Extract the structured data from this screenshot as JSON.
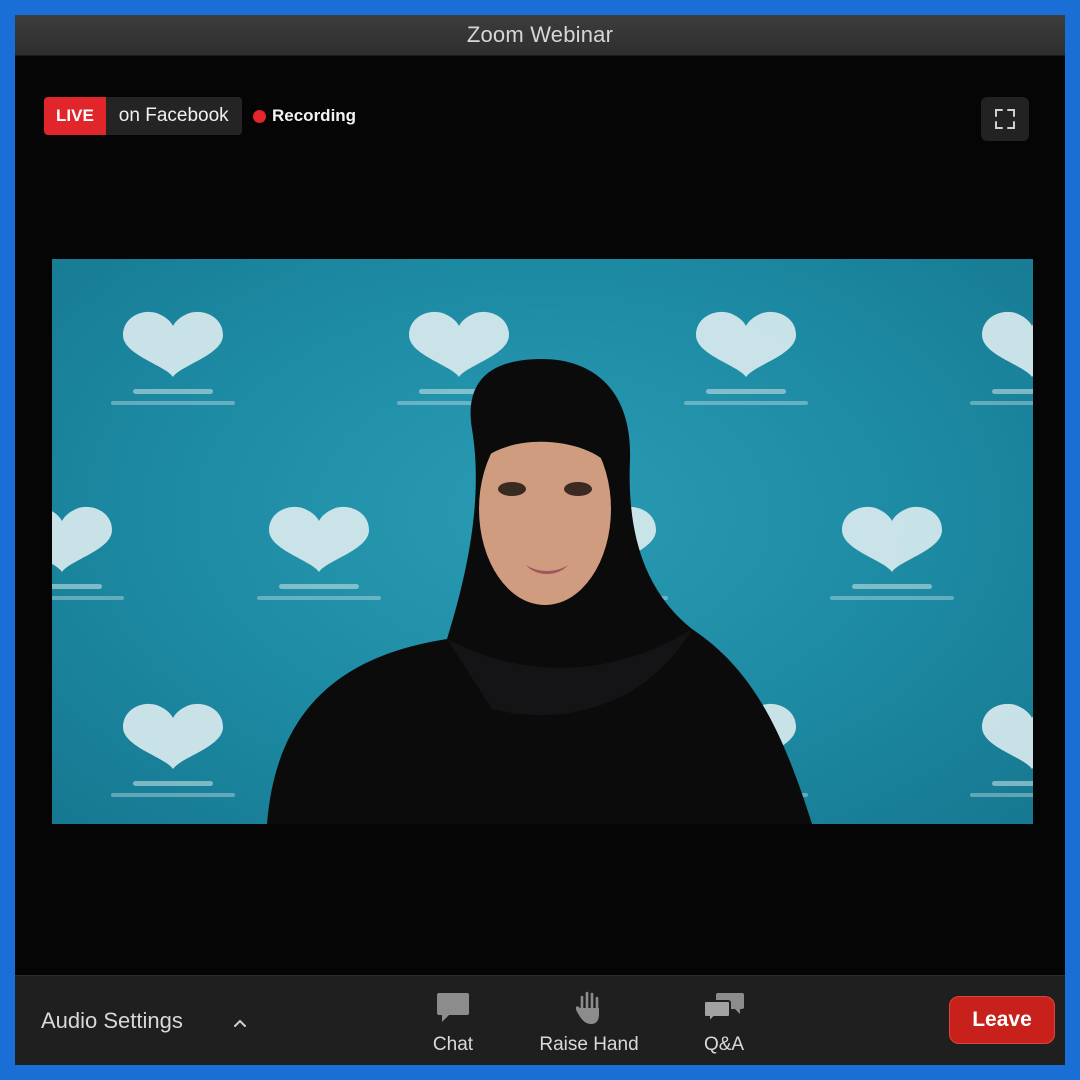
{
  "window": {
    "title": "Zoom Webinar"
  },
  "status": {
    "live_tag": "LIVE",
    "live_destination": "on Facebook",
    "recording_label": "Recording"
  },
  "colors": {
    "live_red": "#e0262a",
    "recording_dot": "#e5252b",
    "leave_red": "#c8211c",
    "frame_blue": "#1a6fd6",
    "backdrop_teal": "#1d8aa3"
  },
  "icons": {
    "fullscreen": "fullscreen-icon",
    "audio_caret": "chevron-up-icon",
    "chat": "chat-icon",
    "raise_hand": "hand-icon",
    "qa": "qa-icon"
  },
  "toolbar": {
    "audio_settings_label": "Audio Settings",
    "chat_label": "Chat",
    "raise_hand_label": "Raise Hand",
    "qa_label": "Q&A",
    "leave_label": "Leave"
  }
}
